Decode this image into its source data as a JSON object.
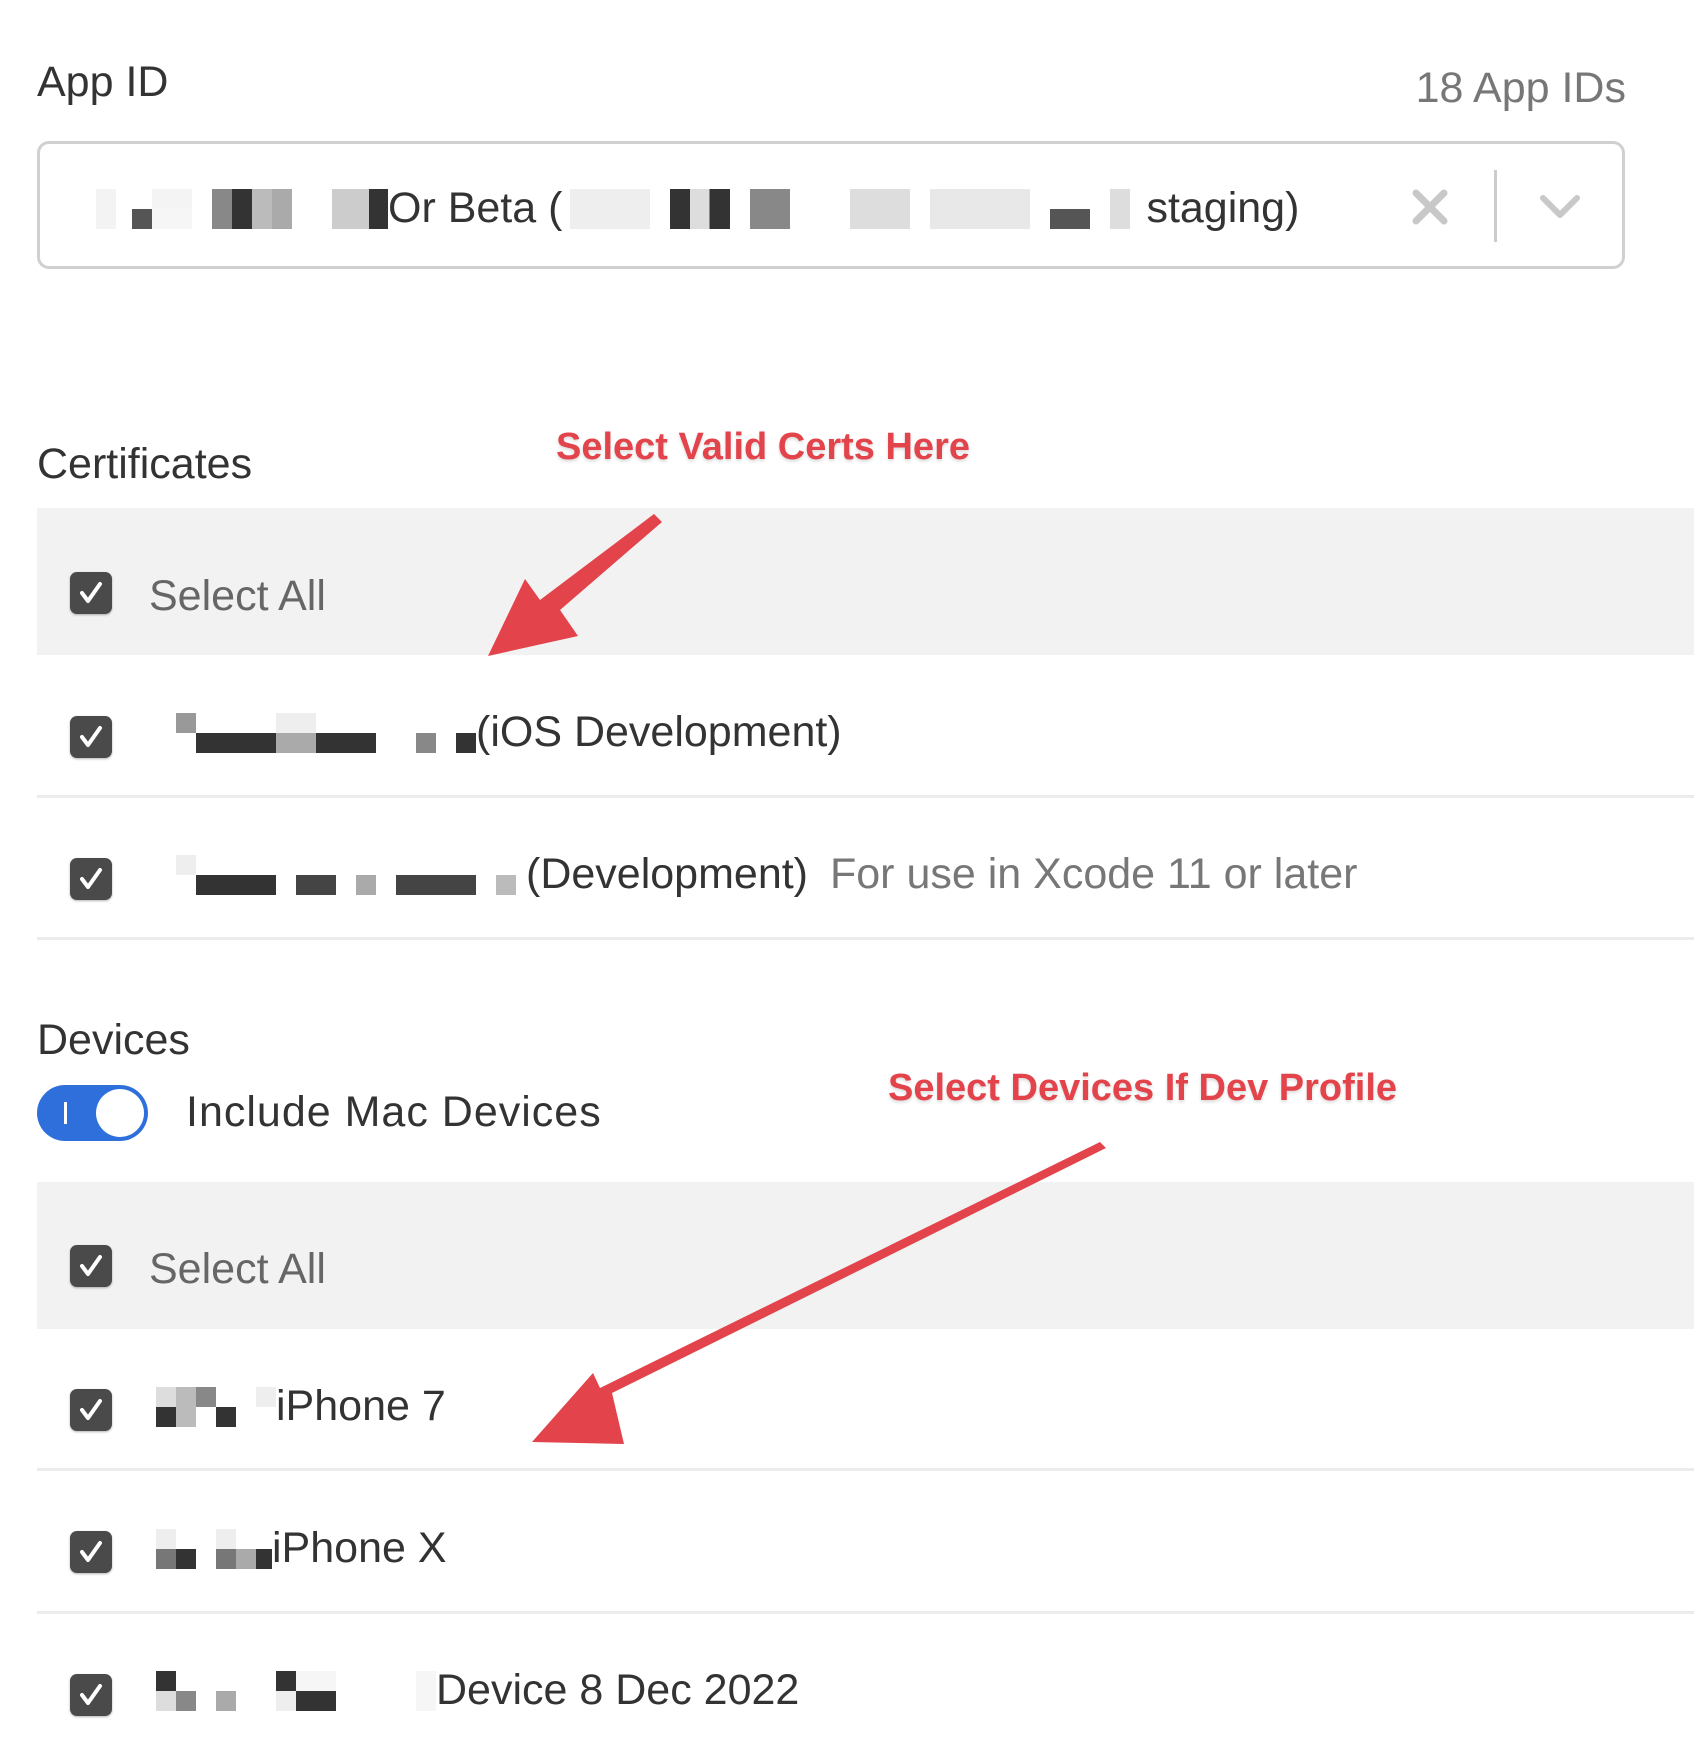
{
  "app_id": {
    "label": "App ID",
    "count": "18 App IDs",
    "selected_value_visible_parts": [
      "Or Beta (",
      "staging)"
    ],
    "clear_icon": "close-icon",
    "dropdown_icon": "chevron-down-icon"
  },
  "certificates": {
    "label": "Certificates",
    "select_all_label": "Select All",
    "select_all_checked": true,
    "items": [
      {
        "name_suffix": "(iOS Development)",
        "note": "",
        "checked": true
      },
      {
        "name_suffix": "(Development)",
        "note": "For use in Xcode 11 or later",
        "checked": true
      }
    ]
  },
  "devices": {
    "label": "Devices",
    "include_mac_label": "Include Mac Devices",
    "include_mac_on": true,
    "select_all_label": "Select All",
    "select_all_checked": true,
    "items": [
      {
        "name_suffix": "iPhone 7",
        "checked": true
      },
      {
        "name_suffix": "iPhone X",
        "checked": true
      },
      {
        "name_suffix": "Device 8 Dec 2022",
        "checked": true
      }
    ]
  },
  "annotations": {
    "certs": "Select Valid Certs Here",
    "devices": "Select Devices If Dev Profile",
    "color": "#e3434b"
  }
}
